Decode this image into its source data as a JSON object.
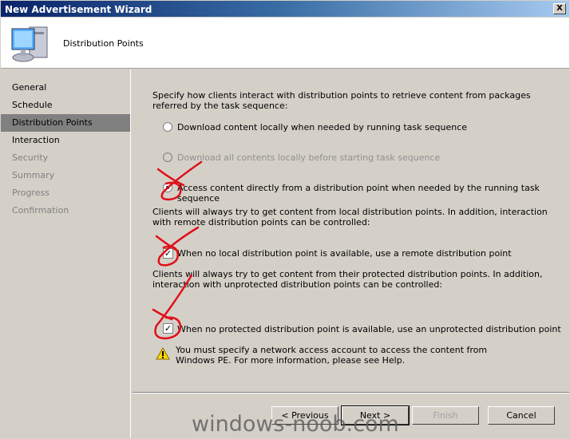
{
  "window": {
    "title": "New Advertisement Wizard",
    "close_label": "X"
  },
  "header": {
    "title": "Distribution Points",
    "icon": "computer-icon"
  },
  "sidebar": {
    "items": [
      {
        "label": "General",
        "state": "normal"
      },
      {
        "label": "Schedule",
        "state": "normal"
      },
      {
        "label": "Distribution Points",
        "state": "selected"
      },
      {
        "label": "Interaction",
        "state": "normal"
      },
      {
        "label": "Security",
        "state": "disabled"
      },
      {
        "label": "Summary",
        "state": "disabled"
      },
      {
        "label": "Progress",
        "state": "disabled"
      },
      {
        "label": "Confirmation",
        "state": "disabled"
      }
    ]
  },
  "main": {
    "intro": "Specify how clients interact with distribution points to retrieve content from packages referred by the task sequence:",
    "radios": [
      {
        "label": "Download content locally when needed by running task sequence",
        "checked": false,
        "enabled": true
      },
      {
        "label": "Download all contents locally before starting task sequence",
        "checked": false,
        "enabled": false
      },
      {
        "label": "Access content directly from a distribution point when needed by the running task sequence",
        "checked": true,
        "enabled": true
      }
    ],
    "local_desc": "Clients will always try to get content from local distribution points. In addition, interaction with remote distribution points can be controlled:",
    "remote_checkbox": {
      "label": "When no local distribution point is available, use a remote distribution point",
      "checked": true
    },
    "protected_desc": "Clients will always try to get content from their protected distribution points. In addition, interaction with unprotected distribution points can be controlled:",
    "unprotected_checkbox": {
      "label": "When no protected distribution point is available, use an unprotected distribution point",
      "checked": true
    },
    "warning": {
      "icon": "warning-icon",
      "text": "You must specify a network access account to access the content from Windows PE.  For more information, please see Help."
    }
  },
  "buttons": {
    "previous": "< Previous",
    "next": "Next >",
    "finish": "Finish",
    "cancel": "Cancel"
  },
  "watermark": "windows-noob.com",
  "colors": {
    "title_start": "#0a246a",
    "title_end": "#a6caf0",
    "selected": "#808080",
    "annotation": "#e0101a"
  }
}
